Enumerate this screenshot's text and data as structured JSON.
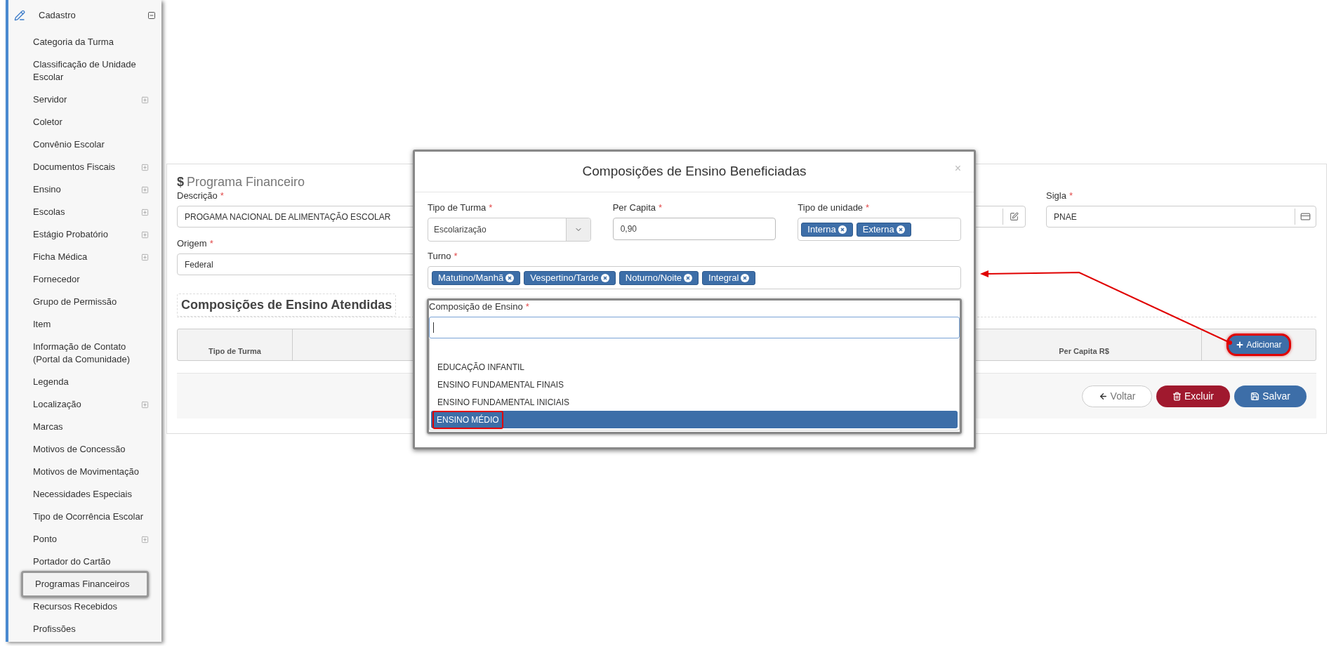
{
  "sidebar": {
    "section": {
      "label": "Cadastro",
      "expanded": true
    },
    "items": [
      {
        "label": "Categoria da Turma",
        "has_children": false,
        "selected": false
      },
      {
        "label": "Classificação de Unidade Escolar",
        "has_children": false,
        "selected": false
      },
      {
        "label": "Servidor",
        "has_children": true,
        "selected": false
      },
      {
        "label": "Coletor",
        "has_children": false,
        "selected": false
      },
      {
        "label": "Convênio Escolar",
        "has_children": false,
        "selected": false
      },
      {
        "label": "Documentos Fiscais",
        "has_children": true,
        "selected": false
      },
      {
        "label": "Ensino",
        "has_children": true,
        "selected": false
      },
      {
        "label": "Escolas",
        "has_children": true,
        "selected": false
      },
      {
        "label": "Estágio Probatório",
        "has_children": true,
        "selected": false
      },
      {
        "label": "Ficha Médica",
        "has_children": true,
        "selected": false
      },
      {
        "label": "Fornecedor",
        "has_children": false,
        "selected": false
      },
      {
        "label": "Grupo de Permissão",
        "has_children": false,
        "selected": false
      },
      {
        "label": "Item",
        "has_children": false,
        "selected": false
      },
      {
        "label": "Informação de Contato (Portal da Comunidade)",
        "has_children": false,
        "selected": false
      },
      {
        "label": "Legenda",
        "has_children": false,
        "selected": false
      },
      {
        "label": "Localização",
        "has_children": true,
        "selected": false
      },
      {
        "label": "Marcas",
        "has_children": false,
        "selected": false
      },
      {
        "label": "Motivos de Concessão",
        "has_children": false,
        "selected": false
      },
      {
        "label": "Motivos de Movimentação",
        "has_children": false,
        "selected": false
      },
      {
        "label": "Necessidades Especiais",
        "has_children": false,
        "selected": false
      },
      {
        "label": "Tipo de Ocorrência Escolar",
        "has_children": false,
        "selected": false
      },
      {
        "label": "Ponto",
        "has_children": true,
        "selected": false
      },
      {
        "label": "Portador do Cartão",
        "has_children": false,
        "selected": false
      },
      {
        "label": "Programas Financeiros",
        "has_children": false,
        "selected": true
      },
      {
        "label": "Recursos Recebidos",
        "has_children": false,
        "selected": false
      },
      {
        "label": "Profissões",
        "has_children": false,
        "selected": false
      }
    ]
  },
  "form": {
    "currency_symbol": "$",
    "title": "Programa Financeiro",
    "descricao": {
      "label": "Descrição",
      "required_mark": "*",
      "value": "PROGAMA NACIONAL DE ALIMENTAÇÃO ESCOLAR"
    },
    "sigla": {
      "label": "Sigla",
      "required_mark": "*",
      "value": "PNAE"
    },
    "origem": {
      "label": "Origem",
      "required_mark": "*",
      "value": "Federal"
    },
    "section_title": "Composições de Ensino Atendidas",
    "table": {
      "column_1": "Tipo de Turma",
      "column_3": "Per Capita R$",
      "add_button": {
        "label": "Adicionar",
        "highlighted": true
      }
    },
    "buttons": [
      {
        "label": "Voltar",
        "kind": "back"
      },
      {
        "label": "Excluir",
        "kind": "delete"
      },
      {
        "label": "Salvar",
        "kind": "save"
      }
    ]
  },
  "modal": {
    "title": "Composições de Ensino Beneficiadas",
    "close": "×",
    "tipo_turma": {
      "label": "Tipo de Turma",
      "required_mark": "*",
      "value": "Escolarização"
    },
    "per_capita": {
      "label": "Per Capita",
      "required_mark": "*",
      "value": "0,90"
    },
    "tipo_unidade": {
      "label": "Tipo de unidade",
      "required_mark": "*",
      "tags": [
        "Interna",
        "Externa"
      ]
    },
    "turno": {
      "label": "Turno",
      "required_mark": "*",
      "tags": [
        "Matutino/Manhã",
        "Vespertino/Tarde",
        "Noturno/Noite",
        "Integral"
      ]
    },
    "composicao": {
      "label": "Composição de Ensino",
      "required_mark": "*",
      "options": [
        {
          "label": "EDUCAÇÃO INFANTIL",
          "selected": false,
          "highlighted": false
        },
        {
          "label": "ENSINO FUNDAMENTAL FINAIS",
          "selected": false,
          "highlighted": false
        },
        {
          "label": "ENSINO FUNDAMENTAL INICIAIS",
          "selected": false,
          "highlighted": false
        },
        {
          "label": "ENSINO MÉDIO",
          "selected": true,
          "highlighted": true
        }
      ]
    }
  },
  "annotation_arrow": true
}
